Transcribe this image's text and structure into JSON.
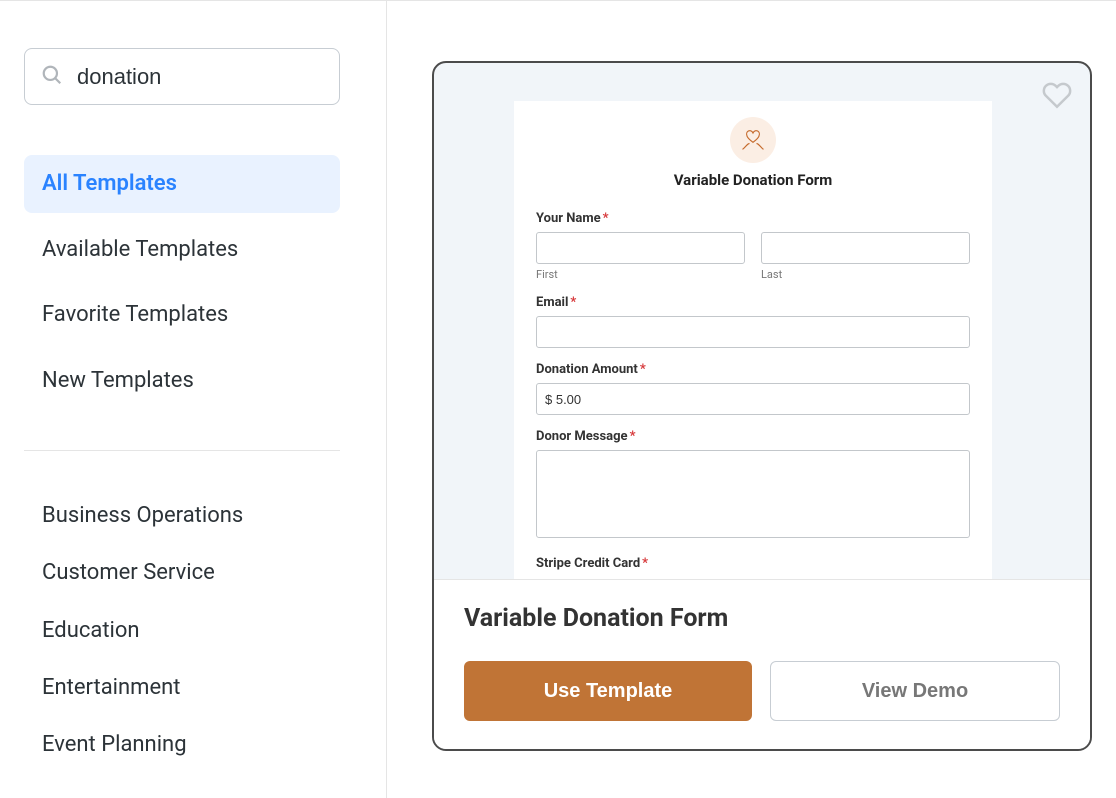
{
  "search": {
    "value": "donation"
  },
  "filters": {
    "all": "All Templates",
    "available": "Available Templates",
    "favorite": "Favorite Templates",
    "new": "New Templates"
  },
  "categories": {
    "biz": "Business Operations",
    "cs": "Customer Service",
    "edu": "Education",
    "ent": "Entertainment",
    "evt": "Event Planning"
  },
  "template": {
    "title": "Variable Donation Form",
    "use_label": "Use Template",
    "demo_label": "View Demo"
  },
  "preview": {
    "form_title": "Variable Donation Form",
    "name_label": "Your Name",
    "first_sub": "First",
    "last_sub": "Last",
    "email_label": "Email",
    "amount_label": "Donation Amount",
    "amount_value": "$ 5.00",
    "message_label": "Donor Message",
    "stripe_label": "Stripe Credit Card",
    "required_marker": "*"
  }
}
